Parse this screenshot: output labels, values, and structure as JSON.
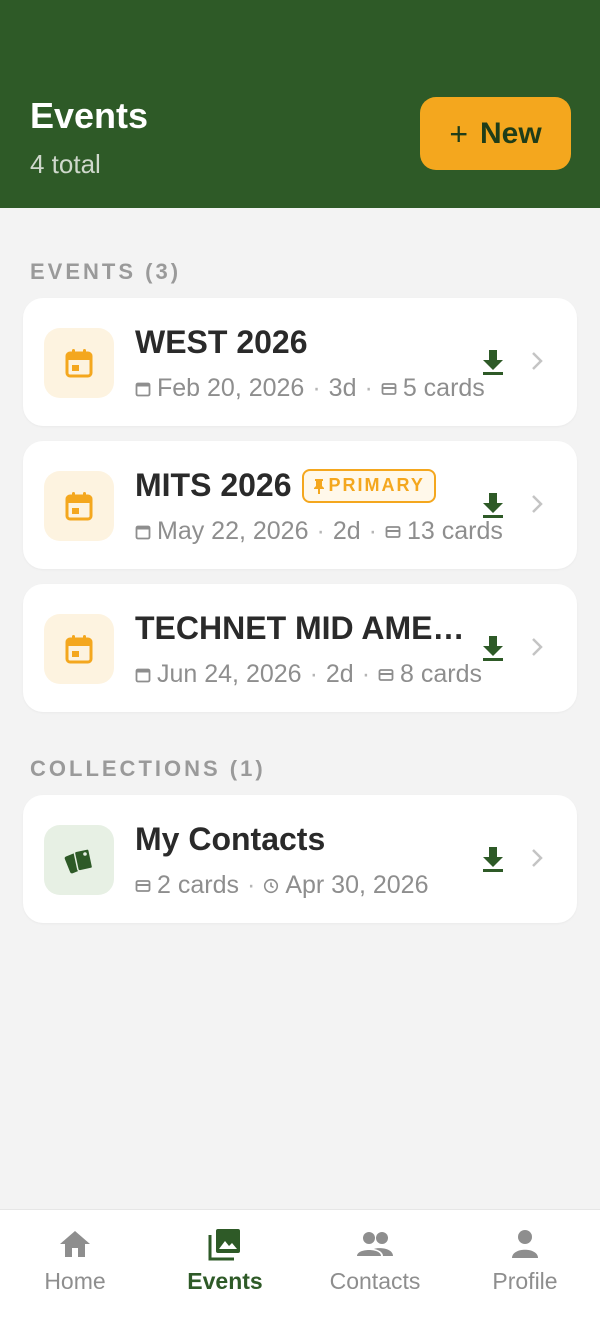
{
  "header": {
    "title": "Events",
    "subtitle": "4 total",
    "new_button": {
      "plus": "+",
      "label": "New"
    }
  },
  "sections": {
    "events": {
      "label": "EVENTS (3)"
    },
    "collections": {
      "label": "COLLECTIONS (1)"
    }
  },
  "events": [
    {
      "name": "WEST 2026",
      "date": "Feb 20, 2026",
      "duration": "3d",
      "cards": "5 cards",
      "icon": "calendar-icon",
      "primary": false
    },
    {
      "name": "MITS 2026",
      "badge": "PRIMARY",
      "date": "May 22, 2026",
      "duration": "2d",
      "cards": "13 cards",
      "icon": "calendar-icon",
      "primary": true
    },
    {
      "name": "TECHNET MID AME…",
      "date": "Jun 24, 2026",
      "duration": "2d",
      "cards": "8 cards",
      "icon": "calendar-icon",
      "primary": false
    }
  ],
  "collections": [
    {
      "name": "My Contacts",
      "cards": "2 cards",
      "updated": "Apr 30, 2026",
      "icon": "cards-icon"
    }
  ],
  "meta_separator": "·",
  "nav": [
    {
      "label": "Home",
      "icon": "home-icon",
      "active": false
    },
    {
      "label": "Events",
      "icon": "photo-library-icon",
      "active": true
    },
    {
      "label": "Contacts",
      "icon": "people-icon",
      "active": false
    },
    {
      "label": "Profile",
      "icon": "person-icon",
      "active": false
    }
  ],
  "colors": {
    "header_bg": "#2e5a27",
    "accent": "#f4a71e",
    "active_nav": "#2e5a27",
    "muted_text": "#8e8e8e",
    "page_bg": "#f3f3f3"
  }
}
